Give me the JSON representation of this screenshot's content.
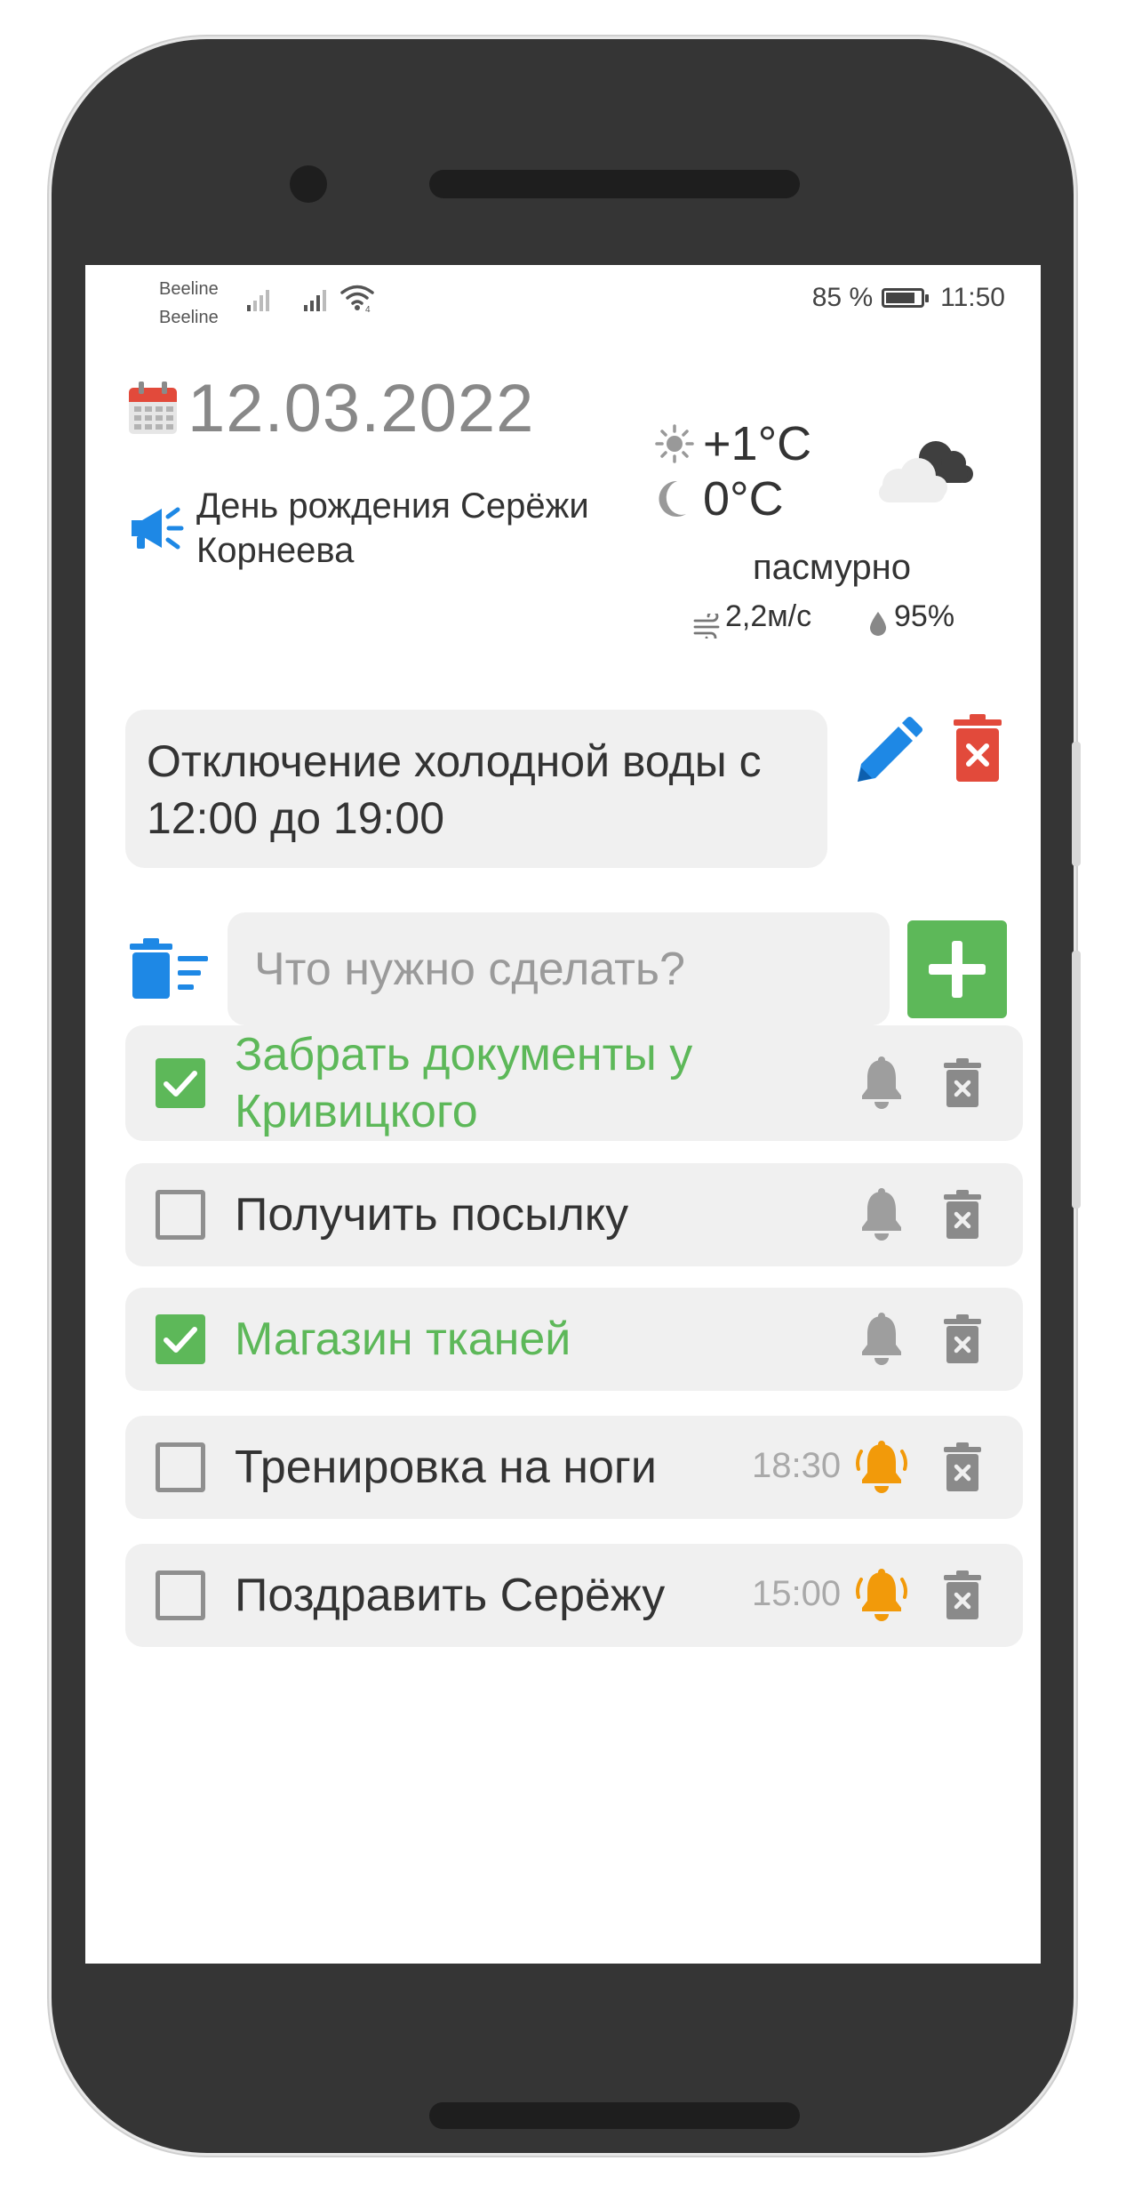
{
  "status_bar": {
    "carrier_1": "Beeline",
    "carrier_2": "Beeline",
    "battery": "85 %",
    "battery_level": 0.85,
    "time": "11:50"
  },
  "header": {
    "date": "12.03.2022",
    "event": "День рождения Серёжи Корнеева"
  },
  "weather": {
    "day_temp": "+1°C",
    "night_temp": "0°C",
    "condition": "пасмурно",
    "wind": "2,2м/с",
    "humidity": "95%"
  },
  "notice": {
    "text": "Отключение холодной воды с 12:00 до 19:00"
  },
  "input": {
    "placeholder": "Что нужно сделать?"
  },
  "tasks": [
    {
      "text": "Забрать документы у Кривицкого",
      "done": true,
      "time": "",
      "alarm": false
    },
    {
      "text": "Получить посылку",
      "done": false,
      "time": "",
      "alarm": false
    },
    {
      "text": "Магазин тканей",
      "done": true,
      "time": "",
      "alarm": false
    },
    {
      "text": "Тренировка на ноги",
      "done": false,
      "time": "18:30",
      "alarm": true
    },
    {
      "text": "Поздравить Серёжу",
      "done": false,
      "time": "15:00",
      "alarm": true
    }
  ],
  "colors": {
    "accent_green": "#5db859",
    "accent_blue": "#1e88e5",
    "delete_red": "#e24a3b",
    "alarm_orange": "#f29a0a",
    "muted_grey": "#9e9e9e"
  }
}
